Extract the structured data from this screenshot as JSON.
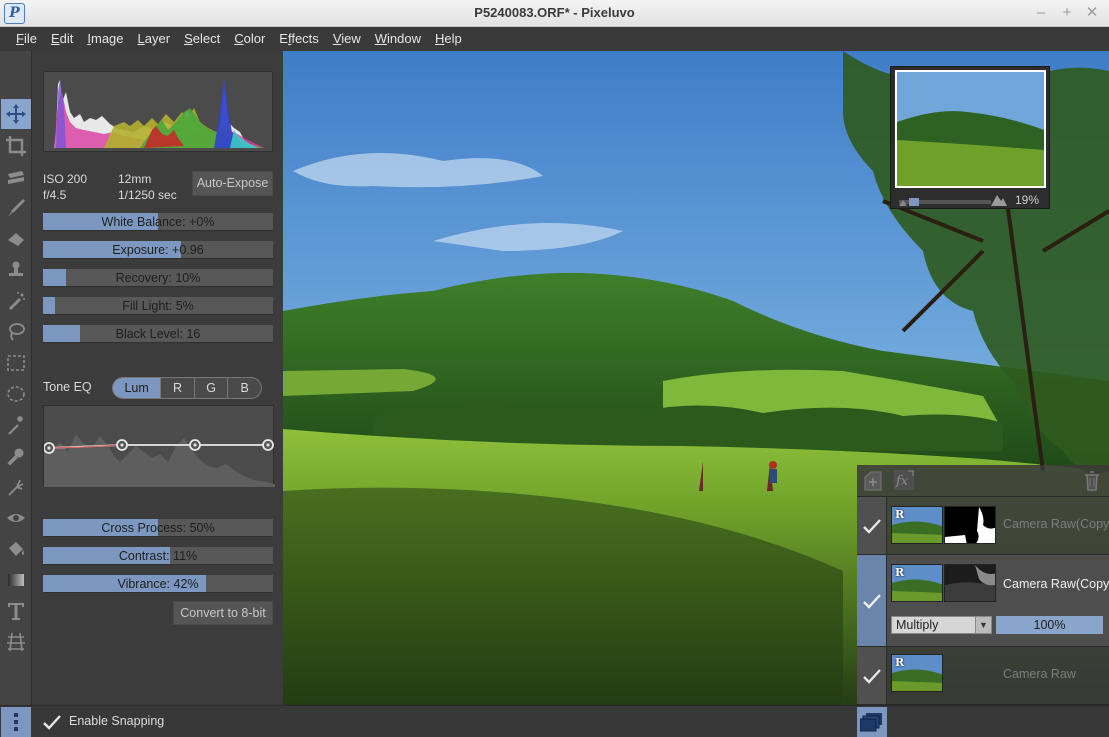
{
  "window": {
    "title": "P5240083.ORF* - Pixeluvo",
    "logo_letter": "P",
    "minimize": "–",
    "maximize": "+",
    "close": "✕"
  },
  "menu": [
    {
      "pre": "",
      "acc": "F",
      "post": "ile"
    },
    {
      "pre": "",
      "acc": "E",
      "post": "dit"
    },
    {
      "pre": "",
      "acc": "I",
      "post": "mage"
    },
    {
      "pre": "",
      "acc": "L",
      "post": "ayer"
    },
    {
      "pre": "",
      "acc": "S",
      "post": "elect"
    },
    {
      "pre": "",
      "acc": "C",
      "post": "olor"
    },
    {
      "pre": "E",
      "acc": "f",
      "post": "fects"
    },
    {
      "pre": "",
      "acc": "V",
      "post": "iew"
    },
    {
      "pre": "",
      "acc": "W",
      "post": "indow"
    },
    {
      "pre": "",
      "acc": "H",
      "post": "elp"
    }
  ],
  "tools": [
    "move-icon",
    "crop-icon",
    "stamp-icon",
    "brush-icon",
    "eraser-icon",
    "clone-icon",
    "healing-icon",
    "lasso-icon",
    "rect-select-icon",
    "ellipse-select-icon",
    "magic-wand-icon",
    "color-picker-icon",
    "smudge-icon",
    "red-eye-icon",
    "bucket-icon",
    "gradient-icon",
    "text-icon",
    "perspective-icon"
  ],
  "camera": {
    "iso": "ISO 200",
    "aperture": "f/4.5",
    "focal": "12mm",
    "shutter": "1/1250 sec",
    "auto_expose": "Auto-Expose"
  },
  "sliders_top": [
    {
      "label": "White Balance: +0%",
      "value": 0.5
    },
    {
      "label": "Exposure: +0.96",
      "value": 0.6
    },
    {
      "label": "Recovery: 10%",
      "value": 0.1
    },
    {
      "label": "Fill Light: 5%",
      "value": 0.05
    },
    {
      "label": "Black Level: 16",
      "value": 0.16
    }
  ],
  "tone_eq": {
    "label": "Tone EQ",
    "tabs": [
      "Lum",
      "R",
      "G",
      "B"
    ],
    "selected": "Lum"
  },
  "sliders_bottom": [
    {
      "label": "Cross Process: 50%",
      "value": 0.5
    },
    {
      "label": "Contrast: 11%",
      "value": 0.55
    },
    {
      "label": "Vibrance: 42%",
      "value": 0.71
    }
  ],
  "convert_button": "Convert to 8-bit",
  "navigator": {
    "zoom": "19%"
  },
  "layers": {
    "items": [
      {
        "name": "Camera Raw(Copy)",
        "selected": false,
        "dim": true
      },
      {
        "name": "Camera Raw(Copy)",
        "selected": true,
        "dim": false
      },
      {
        "name": "Camera Raw",
        "selected": false,
        "dim": true
      }
    ],
    "blend_mode": "Multiply",
    "opacity": "100%",
    "badge": "R"
  },
  "status": {
    "snapping_label": "Enable Snapping",
    "snapping_checked": true
  }
}
